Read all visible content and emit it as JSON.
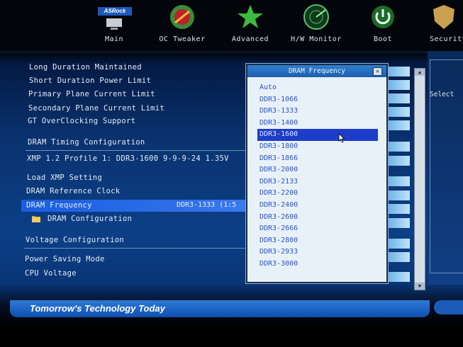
{
  "brand": {
    "logo": "ASRock"
  },
  "nav": [
    {
      "label": "Main",
      "icon": "main-icon"
    },
    {
      "label": "OC Tweaker",
      "icon": "oc-tweaker-icon"
    },
    {
      "label": "Advanced",
      "icon": "star-icon"
    },
    {
      "label": "H/W Monitor",
      "icon": "radar-icon"
    },
    {
      "label": "Boot",
      "icon": "power-icon"
    },
    {
      "label": "Security",
      "icon": "shield-icon"
    }
  ],
  "menu": {
    "long_duration": "Long Duration Maintained",
    "short_duration": "Short Duration Power Limit",
    "primary_plane": "Primary Plane Current Limit",
    "secondary_plane": "Secondary Plane Current Limit",
    "gt_oc": "GT OverClocking Support",
    "dram_timing": "DRAM Timing Configuration",
    "xmp_profile": "XMP 1.2 Profile 1: DDR3-1600 9-9-9-24 1.35V",
    "load_xmp": "Load XMP Setting",
    "dram_ref_clock": "DRAM Reference Clock",
    "dram_frequency": "DRAM Frequency",
    "dram_frequency_value": "DDR3-1333 (1:5",
    "dram_config": "DRAM Configuration",
    "voltage_config": "Voltage Configuration",
    "power_saving": "Power Saving Mode",
    "cpu_voltage": "CPU Voltage"
  },
  "popup": {
    "title": "DRAM Frequency",
    "selected_index": 5,
    "options": [
      "Auto",
      "DDR3-1066",
      "DDR3-1333",
      "DDR3-1400",
      "DDR3-1600",
      "DDR3-1800",
      "DDR3-1866",
      "DDR3-2000",
      "DDR3-2133",
      "DDR3-2200",
      "DDR3-2400",
      "DDR3-2600",
      "DDR3-2666",
      "DDR3-2800",
      "DDR3-2933",
      "DDR3-3000"
    ]
  },
  "help": {
    "text": "Select"
  },
  "footer": {
    "slogan": "Tomorrow's Technology Today"
  },
  "colors": {
    "selection": "#1d3cc8",
    "option_text": "#2a54c8",
    "highlight_row": "#2e6fe8"
  }
}
